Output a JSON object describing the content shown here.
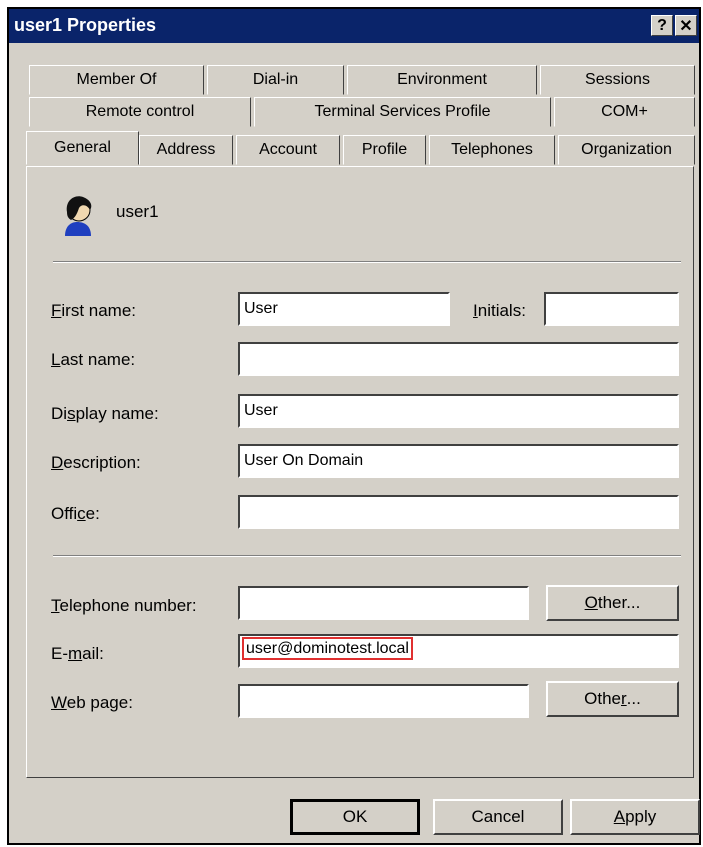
{
  "window": {
    "title": "user1 Properties"
  },
  "title_buttons": {
    "help": "?",
    "close": "✕"
  },
  "tabs": {
    "row1": [
      "Member Of",
      "Dial-in",
      "Environment",
      "Sessions"
    ],
    "row2": [
      "Remote control",
      "Terminal Services Profile",
      "COM+"
    ],
    "row3": [
      "General",
      "Address",
      "Account",
      "Profile",
      "Telephones",
      "Organization"
    ],
    "active": "General"
  },
  "user": {
    "name": "user1",
    "icon": "user-icon"
  },
  "form": {
    "first_name": {
      "label": "First name:",
      "mnemonic": "F",
      "value": "User"
    },
    "initials": {
      "label": "Initials:",
      "mnemonic": "I",
      "value": ""
    },
    "last_name": {
      "label": "Last name:",
      "mnemonic": "L",
      "value": ""
    },
    "display_name": {
      "label": "Display name:",
      "mnemonic": "s",
      "value": "User"
    },
    "description": {
      "label": "Description:",
      "mnemonic": "D",
      "value": "User On Domain"
    },
    "office": {
      "label": "Office:",
      "mnemonic": "c",
      "value": ""
    },
    "telephone": {
      "label": "Telephone number:",
      "mnemonic": "T",
      "value": ""
    },
    "email": {
      "label": "E-mail:",
      "mnemonic": "m",
      "value": "user@dominotest.local"
    },
    "web_page": {
      "label": "Web page:",
      "mnemonic": "W",
      "value": ""
    }
  },
  "buttons": {
    "phone_other": "Other...",
    "web_other": "Other...",
    "ok": "OK",
    "cancel": "Cancel",
    "apply": "Apply"
  },
  "colors": {
    "titlebar": "#0a246a",
    "face": "#d4d0c8",
    "highlight": "#e03030"
  }
}
